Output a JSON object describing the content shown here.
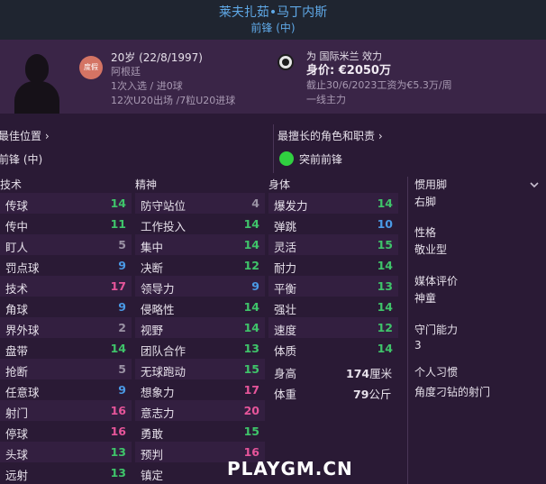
{
  "header": {
    "name": "莱夫扎茹•马丁内斯",
    "position": "前锋 (中)"
  },
  "profile": {
    "badge": "度假",
    "age_dob": "20岁 (22/8/1997)",
    "nationality": "阿根廷",
    "caps": "1次入选 / 进0球",
    "u20": "12次U20出场 /7粒U20进球",
    "club_line": "为 国际米兰 效力",
    "value_label": "身价: ",
    "value": "€2050万",
    "contract": "截止30/6/2023工资为€5.3万/周",
    "squad_status": "一线主力"
  },
  "positions": {
    "best_pos_title": "最佳位置 ›",
    "best_pos": "前锋 (中)",
    "best_role_title": "最擅长的角色和职责 ›",
    "best_role": "突前前锋"
  },
  "sections": {
    "technical": "技术",
    "mental": "精神",
    "physical": "身体"
  },
  "technical": [
    {
      "label": "传球",
      "value": "14",
      "color": "#3fc46a"
    },
    {
      "label": "传中",
      "value": "11",
      "color": "#3fc46a"
    },
    {
      "label": "盯人",
      "value": "5",
      "color": "#9a92a4"
    },
    {
      "label": "罚点球",
      "value": "9",
      "color": "#4a9ae6"
    },
    {
      "label": "技术",
      "value": "17",
      "color": "#e6559a"
    },
    {
      "label": "角球",
      "value": "9",
      "color": "#4a9ae6"
    },
    {
      "label": "界外球",
      "value": "2",
      "color": "#9a92a4"
    },
    {
      "label": "盘带",
      "value": "14",
      "color": "#3fc46a"
    },
    {
      "label": "抢断",
      "value": "5",
      "color": "#9a92a4"
    },
    {
      "label": "任意球",
      "value": "9",
      "color": "#4a9ae6"
    },
    {
      "label": "射门",
      "value": "16",
      "color": "#e6559a"
    },
    {
      "label": "停球",
      "value": "16",
      "color": "#e6559a"
    },
    {
      "label": "头球",
      "value": "13",
      "color": "#3fc46a"
    },
    {
      "label": "远射",
      "value": "13",
      "color": "#3fc46a"
    }
  ],
  "mental": [
    {
      "label": "防守站位",
      "value": "4",
      "color": "#9a92a4"
    },
    {
      "label": "工作投入",
      "value": "14",
      "color": "#3fc46a"
    },
    {
      "label": "集中",
      "value": "14",
      "color": "#3fc46a"
    },
    {
      "label": "决断",
      "value": "12",
      "color": "#3fc46a"
    },
    {
      "label": "领导力",
      "value": "9",
      "color": "#4a9ae6"
    },
    {
      "label": "侵略性",
      "value": "14",
      "color": "#3fc46a"
    },
    {
      "label": "视野",
      "value": "14",
      "color": "#3fc46a"
    },
    {
      "label": "团队合作",
      "value": "13",
      "color": "#3fc46a"
    },
    {
      "label": "无球跑动",
      "value": "15",
      "color": "#3fc46a"
    },
    {
      "label": "想象力",
      "value": "17",
      "color": "#e6559a"
    },
    {
      "label": "意志力",
      "value": "20",
      "color": "#e6559a"
    },
    {
      "label": "勇敢",
      "value": "15",
      "color": "#3fc46a"
    },
    {
      "label": "预判",
      "value": "16",
      "color": "#e6559a"
    },
    {
      "label": "镇定",
      "value": "",
      "color": "#3fc46a"
    }
  ],
  "physical": [
    {
      "label": "爆发力",
      "value": "14",
      "color": "#3fc46a"
    },
    {
      "label": "弹跳",
      "value": "10",
      "color": "#4a9ae6"
    },
    {
      "label": "灵活",
      "value": "15",
      "color": "#3fc46a"
    },
    {
      "label": "耐力",
      "value": "14",
      "color": "#3fc46a"
    },
    {
      "label": "平衡",
      "value": "13",
      "color": "#3fc46a"
    },
    {
      "label": "强壮",
      "value": "14",
      "color": "#3fc46a"
    },
    {
      "label": "速度",
      "value": "12",
      "color": "#3fc46a"
    },
    {
      "label": "体质",
      "value": "14",
      "color": "#3fc46a"
    }
  ],
  "body": {
    "height_label": "身高",
    "height_value": "174",
    "height_unit": "厘米",
    "weight_label": "体重",
    "weight_value": "79",
    "weight_unit": "公斤"
  },
  "side": {
    "foot_label": "惯用脚",
    "foot_value": "右脚",
    "personality_label": "性格",
    "personality_value": "敬业型",
    "media_label": "媒体评价",
    "media_value": "神童",
    "gk_label": "守门能力",
    "gk_value": "3",
    "habits_label": "个人习惯",
    "habits_value": "角度刁钻的射门"
  },
  "watermark": "PLAYGM.CN"
}
